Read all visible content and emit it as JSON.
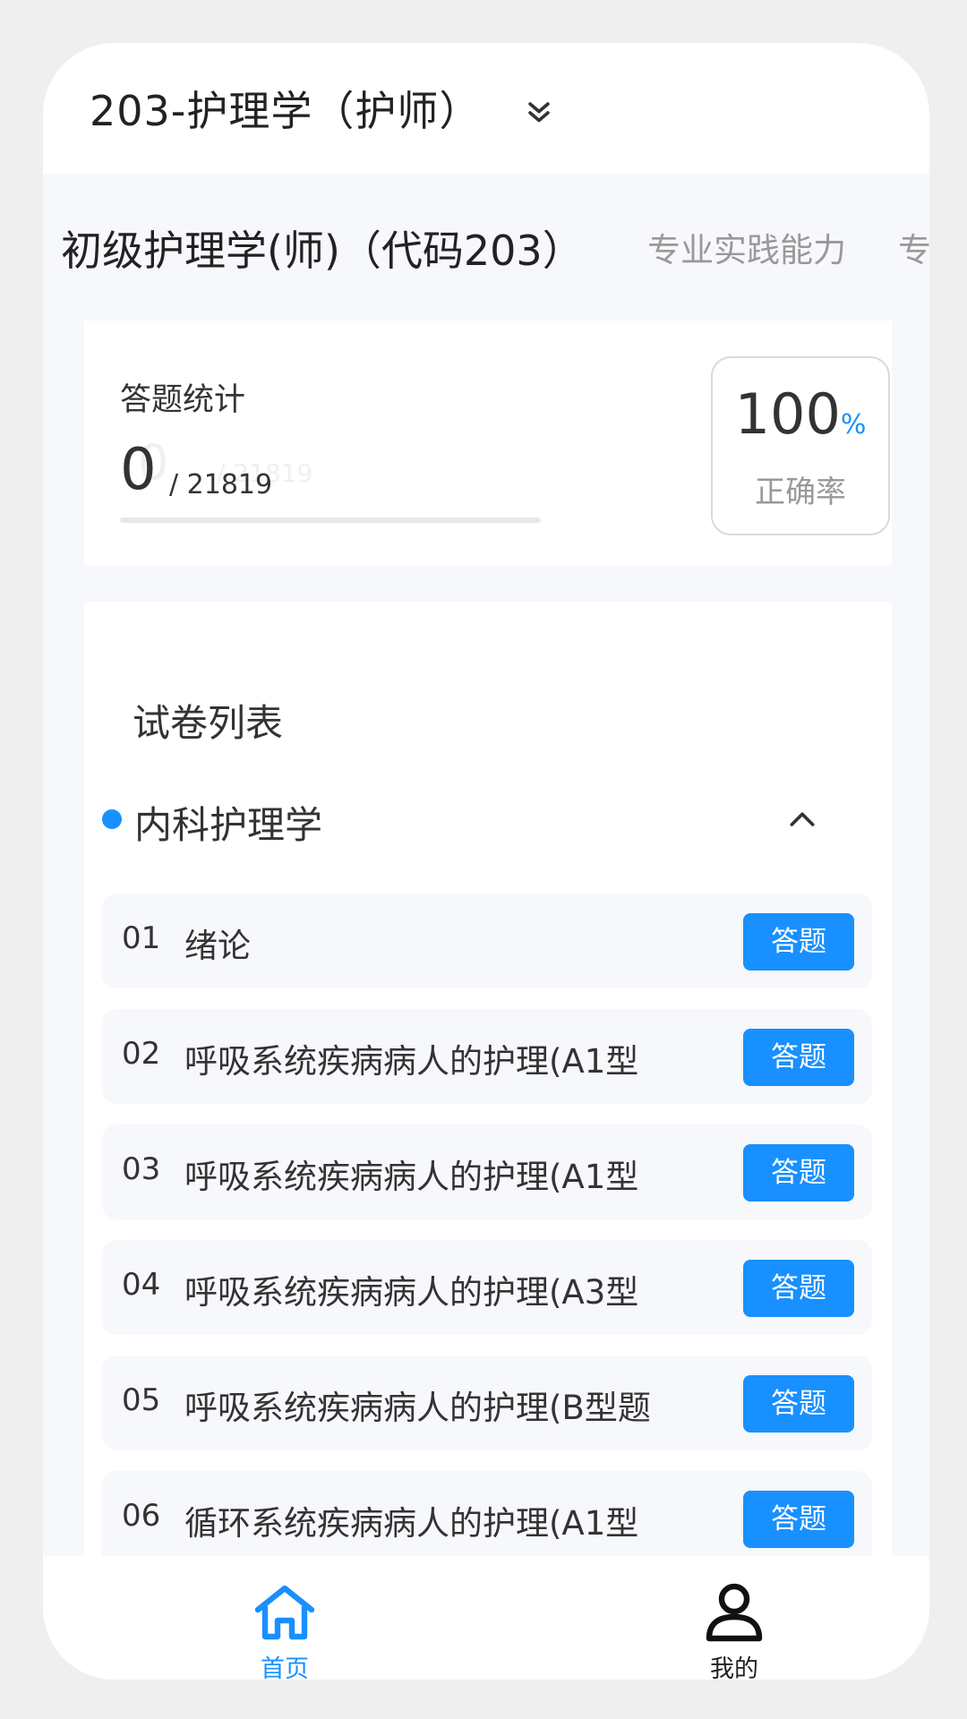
{
  "header": {
    "title": "203-护理学（护师）",
    "dropdown_icon": "double-chevron-down-icon"
  },
  "tabs": [
    {
      "label": "初级护理学(师)（代码203）",
      "active": true
    },
    {
      "label": "专业实践能力",
      "active": false
    },
    {
      "label": "专",
      "active": false
    }
  ],
  "stats": {
    "label": "答题统计",
    "answered": "0",
    "ghost_answered": "0",
    "total": "/ 21819",
    "ghost_total": "/ 21819",
    "progress": 0,
    "accuracy_value": "100",
    "accuracy_unit": "%",
    "accuracy_label": "正确率"
  },
  "paper_list": {
    "title": "试卷列表",
    "category": {
      "label": "内科护理学",
      "toggle_icon": "chevron-up-icon"
    },
    "items": [
      {
        "num": "01",
        "title": "绪论",
        "button": "答题"
      },
      {
        "num": "02",
        "title": "呼吸系统疾病病人的护理(A1型",
        "button": "答题"
      },
      {
        "num": "03",
        "title": "呼吸系统疾病病人的护理(A1型",
        "button": "答题"
      },
      {
        "num": "04",
        "title": "呼吸系统疾病病人的护理(A3型",
        "button": "答题"
      },
      {
        "num": "05",
        "title": "呼吸系统疾病病人的护理(B型题",
        "button": "答题"
      },
      {
        "num": "06",
        "title": "循环系统疾病病人的护理(A1型",
        "button": "答题"
      }
    ]
  },
  "tabbar": {
    "home": {
      "label": "首页",
      "icon": "home-icon"
    },
    "me": {
      "label": "我的",
      "icon": "user-icon"
    }
  },
  "colors": {
    "accent": "#1890ff",
    "background": "#f6f8fc"
  }
}
